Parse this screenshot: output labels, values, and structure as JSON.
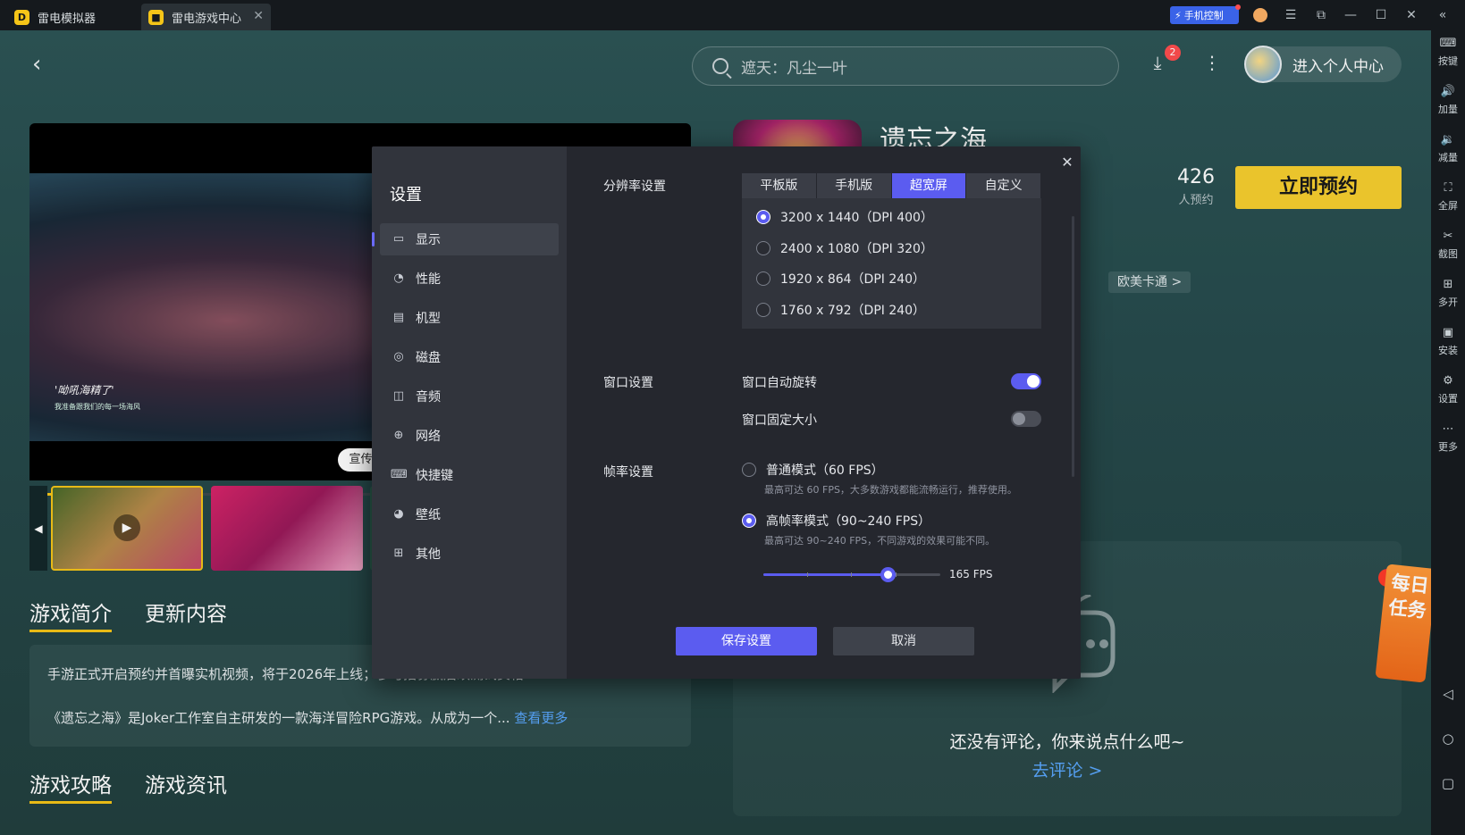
{
  "titlebar": {
    "tabs": [
      {
        "label": "雷电模拟器"
      },
      {
        "label": "雷电游戏中心"
      }
    ],
    "phone_control": "手机控制"
  },
  "header": {
    "search_placeholder": "遮天：凡尘一叶",
    "download_badge": "2",
    "user_center": "进入个人中心"
  },
  "media": {
    "caption": "'呦吼海精了'",
    "caption_sub": "我准备跟我们的每一场海风",
    "promo_label": "宣传片",
    "progress": 0.22
  },
  "game": {
    "title": "遗忘之海",
    "reserve_count": "426",
    "reserve_count_label": "人预约",
    "reserve_button": "立即预约",
    "genre_tag": "欧美卡通 >"
  },
  "sections": {
    "intro_tab": "游戏简介",
    "update_tab": "更新内容",
    "intro_line1": "手游正式开启预约并首曝实机视频，将于2026年上线；参与招募赢后续测试资格",
    "intro_line2": "《遗忘之海》是Joker工作室自主研发的一款海洋冒险RPG游戏。从成为一个...",
    "see_more": "查看更多",
    "guide_tab": "游戏攻略",
    "news_tab": "游戏资讯"
  },
  "comments": {
    "empty_text": "还没有评论，你来说点什么吧~",
    "go_comment": "去评论 >"
  },
  "daily_task": "每日任务",
  "right_sidebar": [
    {
      "label": "按键",
      "icon": "keyboard-icon"
    },
    {
      "label": "加量",
      "icon": "volume-up-icon"
    },
    {
      "label": "减量",
      "icon": "volume-down-icon"
    },
    {
      "label": "全屏",
      "icon": "fullscreen-icon"
    },
    {
      "label": "截图",
      "icon": "scissors-icon"
    },
    {
      "label": "多开",
      "icon": "multi-instance-icon"
    },
    {
      "label": "安装",
      "icon": "apk-icon"
    },
    {
      "label": "设置",
      "icon": "gear-icon"
    },
    {
      "label": "更多",
      "icon": "more-icon"
    }
  ],
  "settings": {
    "title": "设置",
    "nav": [
      {
        "label": "显示",
        "icon": "monitor-icon",
        "active": true
      },
      {
        "label": "性能",
        "icon": "performance-icon"
      },
      {
        "label": "机型",
        "icon": "folder-icon"
      },
      {
        "label": "磁盘",
        "icon": "disk-icon"
      },
      {
        "label": "音频",
        "icon": "gamepad-icon"
      },
      {
        "label": "网络",
        "icon": "globe-icon"
      },
      {
        "label": "快捷键",
        "icon": "keyboard-icon"
      },
      {
        "label": "壁纸",
        "icon": "palette-icon"
      },
      {
        "label": "其他",
        "icon": "grid-icon"
      }
    ],
    "resolution": {
      "label": "分辨率设置",
      "tabs": [
        "平板版",
        "手机版",
        "超宽屏",
        "自定义"
      ],
      "active_tab": "超宽屏",
      "options": [
        {
          "label": "3200 x 1440（DPI 400）",
          "checked": true
        },
        {
          "label": "2400 x 1080（DPI 320）",
          "checked": false
        },
        {
          "label": "1920 x 864（DPI 240）",
          "checked": false
        },
        {
          "label": "1760 x 792（DPI 240）",
          "checked": false
        }
      ]
    },
    "window": {
      "label": "窗口设置",
      "auto_rotate": "窗口自动旋转",
      "auto_rotate_on": true,
      "fixed_size": "窗口固定大小",
      "fixed_size_on": false
    },
    "fps": {
      "label": "帧率设置",
      "normal_mode": "普通模式（60 FPS）",
      "normal_desc": "最高可达 60 FPS，大多数游戏都能流畅运行，推荐使用。",
      "high_mode": "高帧率模式（90~240 FPS）",
      "high_desc": "最高可达 90~240 FPS，不同游戏的效果可能不同。",
      "selected": "high",
      "value_label": "165 FPS",
      "slider_fraction": 0.7
    },
    "save_button": "保存设置",
    "cancel_button": "取消"
  },
  "colors": {
    "accent": "#5b5cf0",
    "reserve": "#f7cf2f",
    "link": "#5aa8ff"
  }
}
